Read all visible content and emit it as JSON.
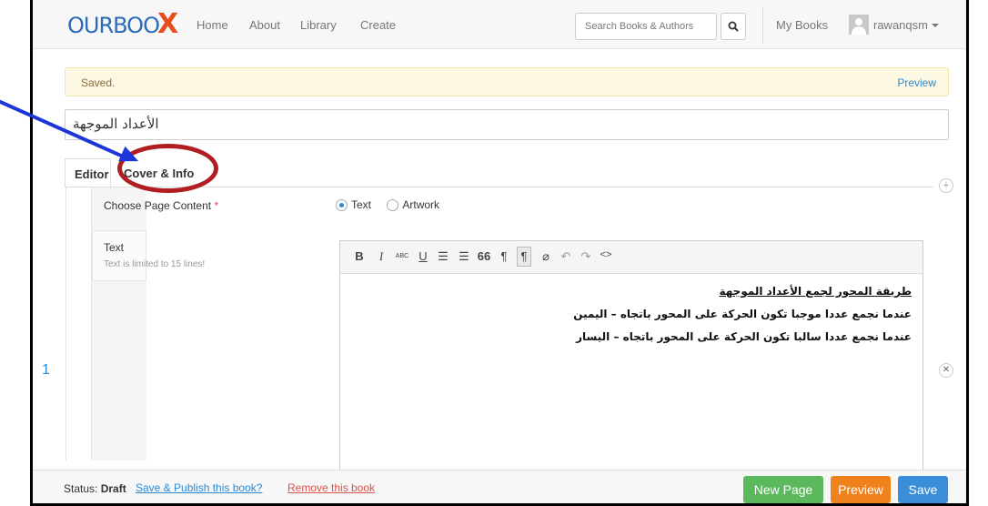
{
  "navbar": {
    "logo_text": "OURBOO",
    "logo_x": "X",
    "links": [
      "Home",
      "About",
      "Library",
      "Create"
    ],
    "search_placeholder": "Search Books & Authors",
    "my_books": "My Books",
    "username": "rawanqsm"
  },
  "alert": {
    "message": "Saved.",
    "preview_link": "Preview"
  },
  "book_title": "الأعداد الموجهة",
  "tabs": {
    "editor": "Editor",
    "cover": "Cover & Info"
  },
  "page": {
    "number": "1",
    "choose_label": "Choose Page Content",
    "required_mark": "*",
    "option_text": "Text",
    "option_artwork": "Artwork",
    "text_label": "Text",
    "text_hint": "Text is limited to 15 lines!"
  },
  "editor": {
    "toolbar": [
      "B",
      "I",
      "ABC",
      "U",
      "☰",
      "☰",
      "66",
      "¶",
      "¶",
      "⌀",
      "↶",
      "↷",
      "<>"
    ],
    "lines": [
      "طريقة المحور لجمع الأعداد الموجهة",
      "عندما نجمع عددا موجبا تكون الحركة على المحور باتجاه – اليمين",
      "عندما نجمع عددا سالبا تكون الحركة على المحور باتجاه – اليسار"
    ]
  },
  "bottom": {
    "status_label": "Status:",
    "status_value": "Draft",
    "publish_link": "Save & Publish this book?",
    "remove_link": "Remove this book",
    "new_page": "New Page",
    "preview": "Preview",
    "save": "Save"
  },
  "colors": {
    "annotation_ellipse": "#b01e22",
    "annotation_arrow": "#1d36d8",
    "link_blue": "#2a8ad6"
  }
}
